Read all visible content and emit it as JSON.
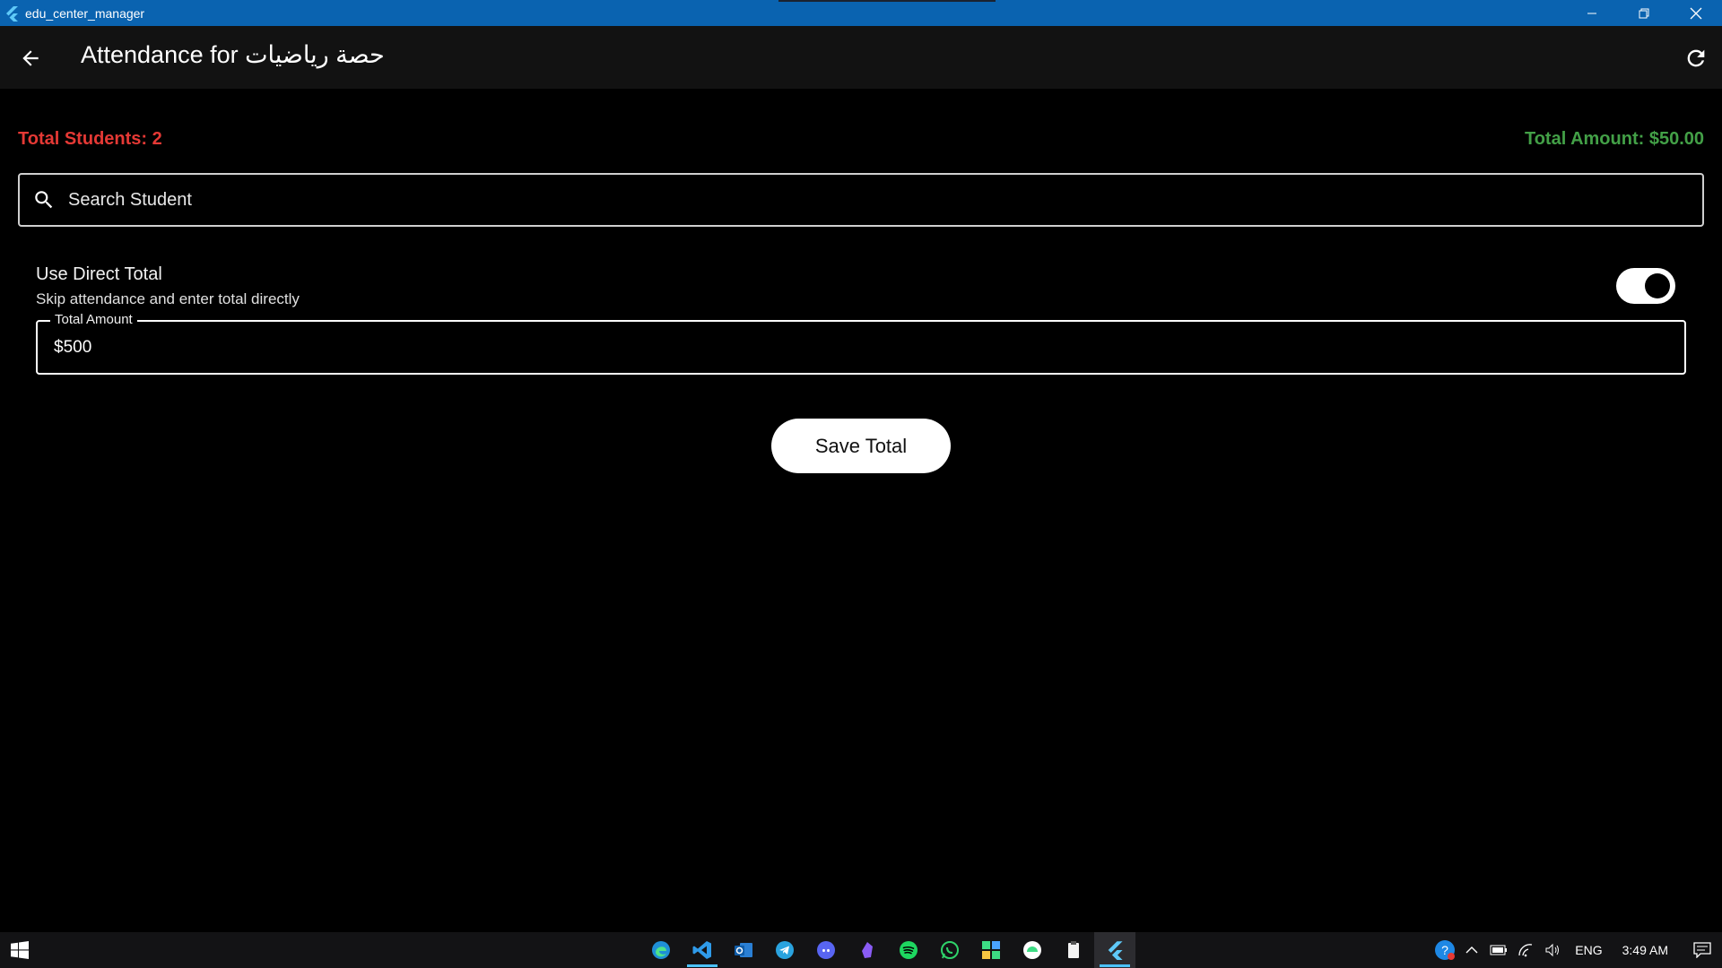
{
  "window": {
    "title": "edu_center_manager"
  },
  "appbar": {
    "title": "Attendance for حصة رياضيات"
  },
  "summary": {
    "total_students": "Total Students: 2",
    "total_amount": "Total Amount: $50.00",
    "students_color": "#e53935",
    "amount_color": "#43a047"
  },
  "search": {
    "placeholder": "Search Student"
  },
  "direct_total": {
    "title": "Use Direct Total",
    "subtitle": "Skip attendance and enter total directly",
    "enabled": true
  },
  "amount_field": {
    "label": "Total Amount",
    "value": "$500"
  },
  "save_button": {
    "label": "Save Total"
  },
  "taskbar": {
    "apps": [
      "edge-icon",
      "vscode-icon",
      "outlook-icon",
      "telegram-icon",
      "discord-icon",
      "obsidian-icon",
      "spotify-icon",
      "whatsapp-icon",
      "app-icon",
      "android-icon",
      "notepad-icon",
      "flutter-icon"
    ],
    "language": "ENG",
    "time": "3:49 AM"
  }
}
